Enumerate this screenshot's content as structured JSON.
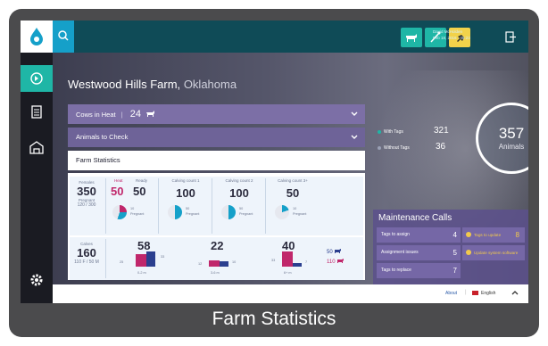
{
  "topbar": {
    "user_name": "David McHolden",
    "user_date": "Feb 18, 2016 · 08:23",
    "quick_colors": [
      "#1fb6a6",
      "#1fb6a6",
      "#f2d24a"
    ]
  },
  "farm": {
    "name": "Westwood Hills Farm,",
    "state": "Oklahoma"
  },
  "accordions": {
    "heat_label": "Cows in Heat",
    "heat_count": "24",
    "check_label": "Animals to Check",
    "stats_label": "Farm Statistics"
  },
  "females": {
    "label": "Females",
    "total": "350",
    "pregnant_label": "Pregnant",
    "pregnant_value": "120 / 300"
  },
  "stages": [
    {
      "label_a": "Heat",
      "value_a": "50",
      "label_b": "Ready",
      "value_b": "50",
      "pie_label": "10",
      "pie_sub": "Pregnant"
    },
    {
      "label": "Calving count 1",
      "value": "100",
      "pie_label": "50",
      "pie_sub": "Pregnant"
    },
    {
      "label": "Calving count 2",
      "value": "100",
      "pie_label": "50",
      "pie_sub": "Pregnant"
    },
    {
      "label": "Calving count 3+",
      "value": "50",
      "pie_label": "10",
      "pie_sub": "Pregnant"
    }
  ],
  "calves": {
    "label": "Calves",
    "total": "160",
    "ratio": "110 F / 50 M",
    "groups": [
      {
        "value": "58",
        "left": "25",
        "right": "33",
        "range": "0-2 m"
      },
      {
        "value": "22",
        "left": "12",
        "right": "10",
        "range": "3-6 m"
      },
      {
        "value": "40",
        "left": "33",
        "right": "7",
        "range": "6+ m"
      }
    ],
    "summary": [
      {
        "value": "50",
        "icon": "cow-icon"
      },
      {
        "value": "110",
        "icon": "cow-icon"
      }
    ]
  },
  "tags": {
    "with_label": "With Tags",
    "with_value": "321",
    "without_label": "Without Tags",
    "without_value": "36"
  },
  "animals": {
    "count": "357",
    "label": "Animals"
  },
  "maintenance": {
    "title": "Maintenance Calls",
    "left_rows": [
      {
        "label": "Tags to assign",
        "count": "4"
      },
      {
        "label": "Assignment issues",
        "count": "5"
      },
      {
        "label": "Tags to replace",
        "count": "7"
      }
    ],
    "right_rows": [
      {
        "label": "Tags to update",
        "count": "8"
      },
      {
        "label": "Update system software",
        "count": ""
      }
    ]
  },
  "footer": {
    "about": "About",
    "language": "English"
  },
  "caption": "Farm Statistics"
}
